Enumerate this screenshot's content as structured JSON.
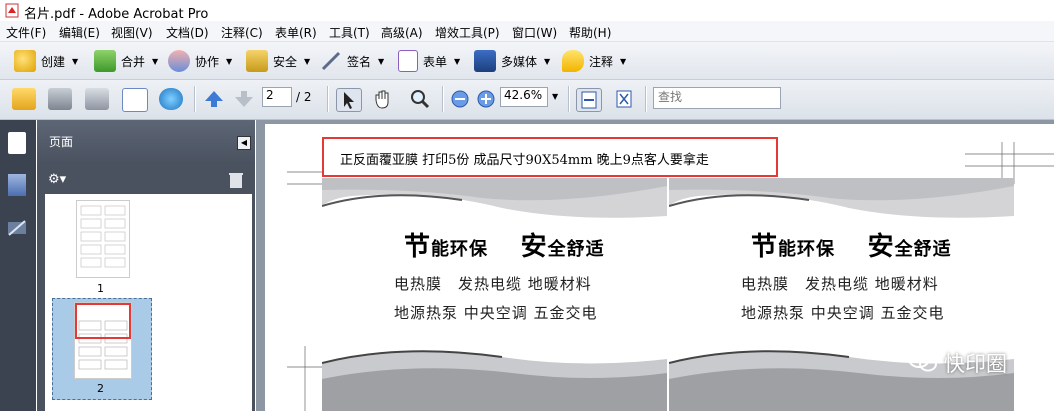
{
  "window": {
    "title": "名片.pdf - Adobe Acrobat Pro"
  },
  "menubar": {
    "items": [
      "文件(F)",
      "编辑(E)",
      "视图(V)",
      "文档(D)",
      "注释(C)",
      "表单(R)",
      "工具(T)",
      "高级(A)",
      "增效工具(P)",
      "窗口(W)",
      "帮助(H)"
    ]
  },
  "toolbar": {
    "create": "创建",
    "combine": "合并",
    "collaborate": "协作",
    "secure": "安全",
    "sign": "签名",
    "forms": "表单",
    "multimedia": "多媒体",
    "comment": "注释"
  },
  "nav": {
    "page_current": "2",
    "page_total": "/ 2",
    "zoom": "42.6%",
    "find_placeholder": "查找"
  },
  "side_panel": {
    "title": "页面",
    "thumb_labels": [
      "1",
      "2"
    ]
  },
  "document": {
    "note": "正反面覆亚膜 打印5份 成品尺寸90X54mm 晚上9点客人要拿走",
    "card": {
      "slogan_a_big": "节",
      "slogan_a_rest": "能环保",
      "slogan_b_big": "安",
      "slogan_b_rest": "全舒适",
      "line1": "电热膜　发热电缆 地暖材料",
      "line2": "地源热泵 中央空调 五金交电"
    }
  },
  "watermark": "快印圈",
  "colors": {
    "accent_red": "#e53935",
    "panel": "#4a5260"
  }
}
